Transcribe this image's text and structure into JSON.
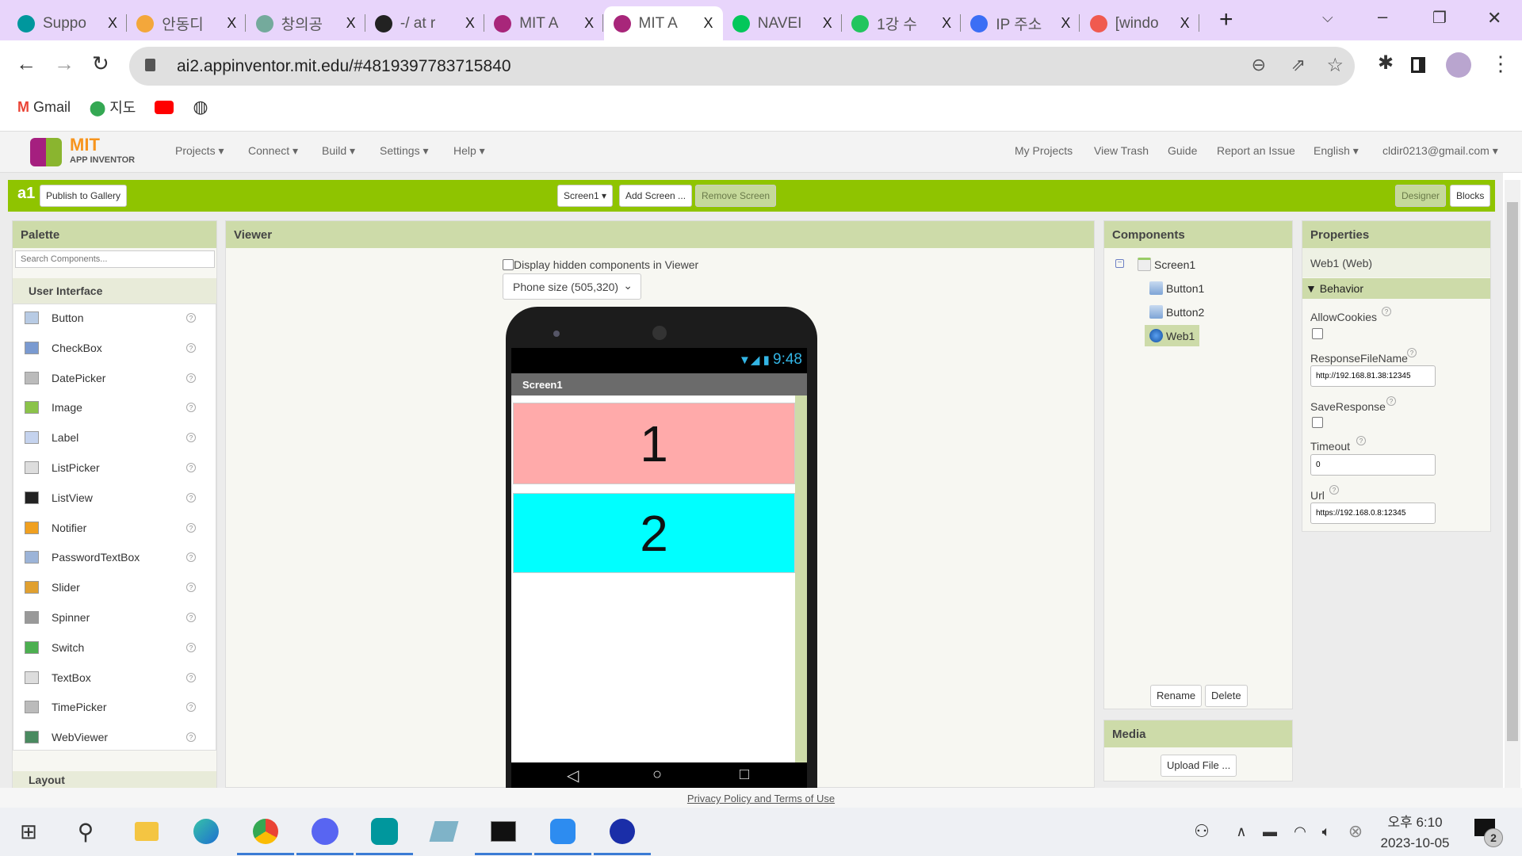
{
  "browser": {
    "tabs": [
      {
        "label": "Suppo",
        "color": "#00979d"
      },
      {
        "label": "안동디",
        "color": "#f3a73b"
      },
      {
        "label": "창의공",
        "color": "#74aa9c"
      },
      {
        "label": "-/ at r",
        "color": "#222222"
      },
      {
        "label": "MIT A",
        "color": "#a8267a"
      },
      {
        "label": "MIT A",
        "color": "#a8267a",
        "active": true
      },
      {
        "label": "NAVEI",
        "color": "#03c75a"
      },
      {
        "label": "1강 수",
        "color": "#22c55e"
      },
      {
        "label": "IP 주소",
        "color": "#3b6ef5"
      },
      {
        "label": "[windo",
        "color": "#f05a4f"
      }
    ],
    "close_glyph": "X",
    "new_tab": "+",
    "url": "ai2.appinventor.mit.edu/#4819397783715840",
    "bookmarks": [
      {
        "label": "Gmail"
      },
      {
        "label": "지도"
      },
      {
        "label": ""
      },
      {
        "label": ""
      }
    ]
  },
  "app": {
    "logo_top": "MIT",
    "logo_bottom": "APP INVENTOR",
    "menus": [
      "Projects ▾",
      "Connect ▾",
      "Build ▾",
      "Settings ▾",
      "Help ▾"
    ],
    "right_links": [
      "My Projects",
      "View Trash",
      "Guide",
      "Report an Issue",
      "English ▾",
      "cldir0213@gmail.com ▾"
    ],
    "project_name": "a1",
    "publish": "Publish to Gallery",
    "screen_select": "Screen1 ▾",
    "add_screen": "Add Screen ...",
    "remove_screen": "Remove Screen",
    "designer": "Designer",
    "blocks": "Blocks",
    "accent": "#8fc400"
  },
  "palette": {
    "title": "Palette",
    "search_placeholder": "Search Components...",
    "category": "User Interface",
    "items": [
      "Button",
      "CheckBox",
      "DatePicker",
      "Image",
      "Label",
      "ListPicker",
      "ListView",
      "Notifier",
      "PasswordTextBox",
      "Slider",
      "Spinner",
      "Switch",
      "TextBox",
      "TimePicker",
      "WebViewer"
    ],
    "next_category": "Layout",
    "help": "?"
  },
  "viewer": {
    "title": "Viewer",
    "hidden_label": "Display hidden components in Viewer",
    "size_select": "Phone size (505,320)",
    "status_time": "9:48",
    "screen_title": "Screen1",
    "buttons": [
      {
        "text": "1",
        "color": "#ffaaaa"
      },
      {
        "text": "2",
        "color": "#00ffff"
      }
    ]
  },
  "components": {
    "title": "Components",
    "tree": [
      "Screen1",
      "Button1",
      "Button2",
      "Web1"
    ],
    "selected": "Web1",
    "rename": "Rename",
    "delete": "Delete",
    "media_title": "Media",
    "upload": "Upload File ..."
  },
  "properties": {
    "title": "Properties",
    "component": "Web1 (Web)",
    "group": "Behavior",
    "allow_cookies_label": "AllowCookies",
    "allow_cookies": false,
    "response_file_label": "ResponseFileName",
    "response_file": "http://192.168.81.38:12345",
    "save_response_label": "SaveResponse",
    "save_response": false,
    "timeout_label": "Timeout",
    "timeout": "0",
    "url_label": "Url",
    "url": "https://192.168.0.8:12345"
  },
  "footer": {
    "privacy": "Privacy Policy and Terms of Use"
  },
  "taskbar": {
    "time": "오후 6:10",
    "date": "2023-10-05",
    "notifications": "2"
  }
}
